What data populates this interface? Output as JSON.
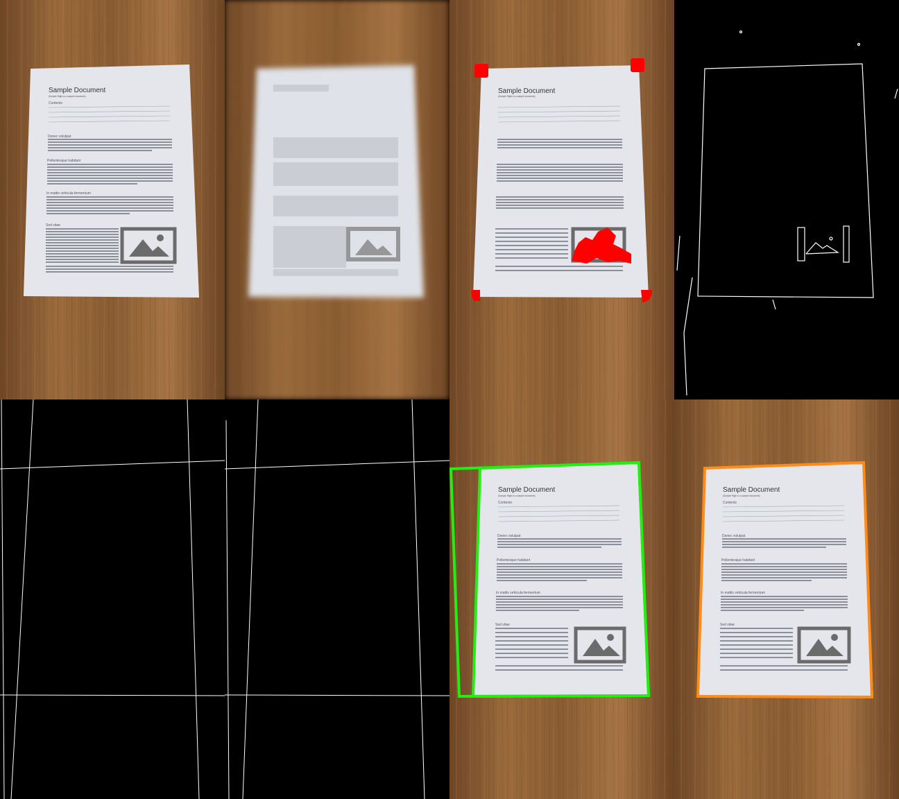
{
  "panels": [
    {
      "id": "original"
    },
    {
      "id": "blurred"
    },
    {
      "id": "corners-detected"
    },
    {
      "id": "edge-map"
    },
    {
      "id": "hough-lines"
    },
    {
      "id": "candidate-quads"
    },
    {
      "id": "final-quad"
    }
  ],
  "document": {
    "title": "Sample Document",
    "subtitle": "(Sample Right to a sample document)",
    "contents_label": "Contents",
    "toc": [
      "Donec volutpat",
      "Pellentesque habitant",
      "In mattis vehicula fermentum",
      "Sed vitae"
    ],
    "sections": [
      "Donec volutpat",
      "Pellentesque habitant",
      "In mattis vehicula fermentum",
      "Sed vitae"
    ]
  },
  "colors": {
    "wood": "#8a5e33",
    "paper": "#e6e8ee",
    "corner_marker": "#ff0000",
    "quad_green": "#22ee11",
    "quad_orange": "#ff8c1a",
    "edge": "#ffffff"
  }
}
